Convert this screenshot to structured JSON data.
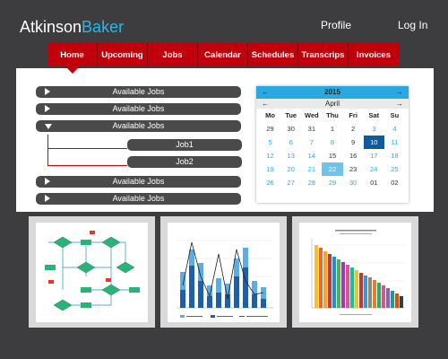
{
  "header": {
    "logo_left": "Atkinson",
    "logo_right": "Baker",
    "profile": "Profile",
    "login": "Log In"
  },
  "nav": {
    "tabs": [
      "Home",
      "Upcoming",
      "Jobs",
      "Calendar",
      "Schedules",
      "Transcrips",
      "Invoices"
    ],
    "active": "Home"
  },
  "accordion": {
    "items": [
      {
        "label": "Available Jobs",
        "expanded": false
      },
      {
        "label": "Available Jobs",
        "expanded": false
      },
      {
        "label": "Available Jobs",
        "expanded": true
      },
      {
        "label": "Available Jobs",
        "expanded": false
      },
      {
        "label": "Available Jobs",
        "expanded": false
      }
    ],
    "jobs": [
      "Job1",
      "Job2"
    ]
  },
  "calendar": {
    "year": "2015",
    "month": "April",
    "prev": "←",
    "next": "→",
    "weekdays": [
      "Mo",
      "Tue",
      "Wed",
      "Thu",
      "Fri",
      "Sat",
      "Su"
    ],
    "weeks": [
      [
        "29",
        "30",
        "31",
        "1",
        "2",
        "3",
        "4"
      ],
      [
        "5",
        "6",
        "7",
        "8",
        "9",
        "10",
        "11"
      ],
      [
        "12",
        "13",
        "14",
        "15",
        "16",
        "17",
        "18"
      ],
      [
        "19",
        "20",
        "21",
        "22",
        "23",
        "24",
        "25"
      ],
      [
        "26",
        "27",
        "28",
        "29",
        "30",
        "01",
        "02"
      ]
    ],
    "selected_day": "10",
    "highlighted_day": "22",
    "accent": "#29a9e0"
  },
  "thumbnails": [
    {
      "icon": "flowchart-thumbnail"
    },
    {
      "icon": "bar-line-chart-thumbnail"
    },
    {
      "icon": "bar-chart-thumbnail"
    }
  ],
  "colors": {
    "brand_red": "#c0000b",
    "logo_accent": "#29b6e8",
    "background": "#3d3d3f"
  }
}
